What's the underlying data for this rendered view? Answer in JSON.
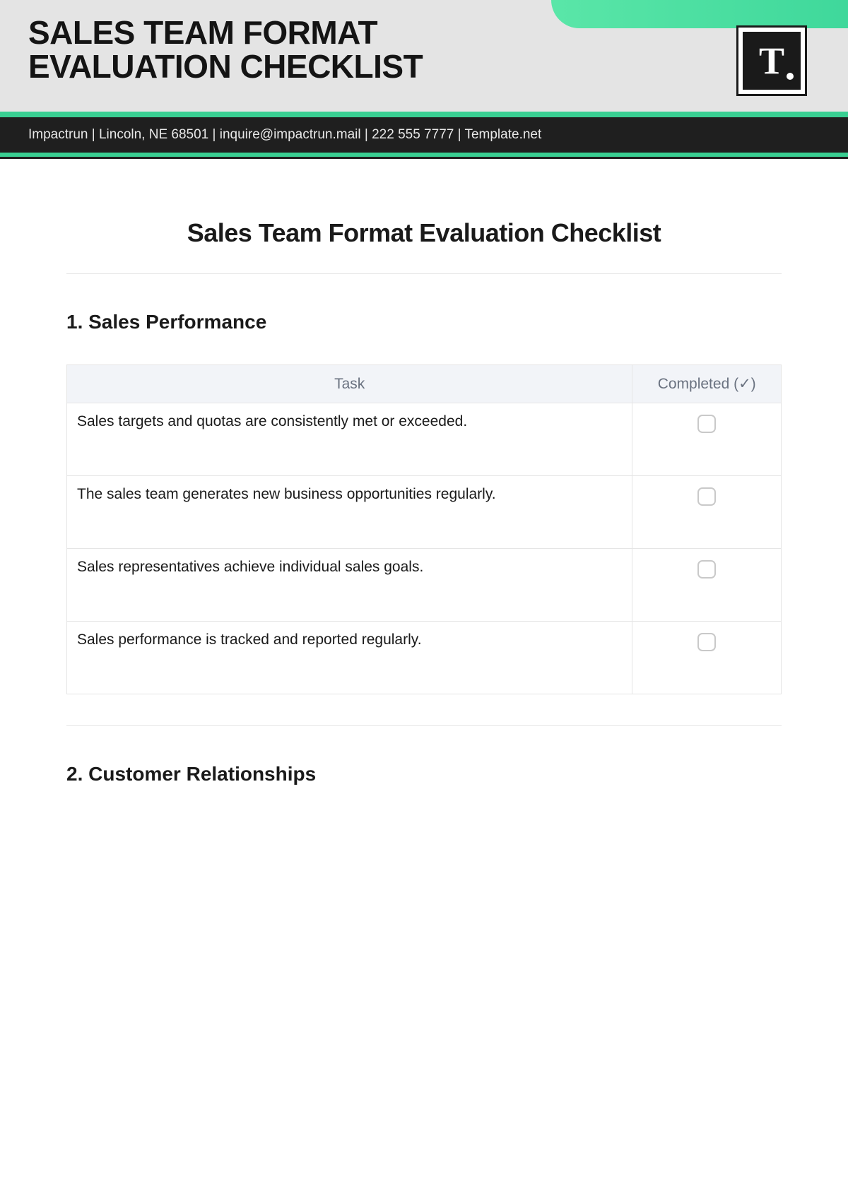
{
  "header": {
    "title_line1": "SALES TEAM FORMAT",
    "title_line2": "EVALUATION CHECKLIST",
    "logo_letter": "T"
  },
  "info_bar": "Impactrun | Lincoln, NE 68501 | inquire@impactrun.mail | 222 555 7777 | Template.net",
  "document": {
    "title": "Sales Team Format Evaluation Checklist",
    "sections": [
      {
        "heading": "1. Sales Performance",
        "columns": {
          "task": "Task",
          "completed": "Completed (✓)"
        },
        "rows": [
          {
            "task": "Sales targets and quotas are consistently met or exceeded.",
            "completed": false
          },
          {
            "task": "The sales team generates new business opportunities regularly.",
            "completed": false
          },
          {
            "task": "Sales representatives achieve individual sales goals.",
            "completed": false
          },
          {
            "task": "Sales performance is tracked and reported regularly.",
            "completed": false
          }
        ]
      },
      {
        "heading": "2. Customer Relationships"
      }
    ]
  }
}
